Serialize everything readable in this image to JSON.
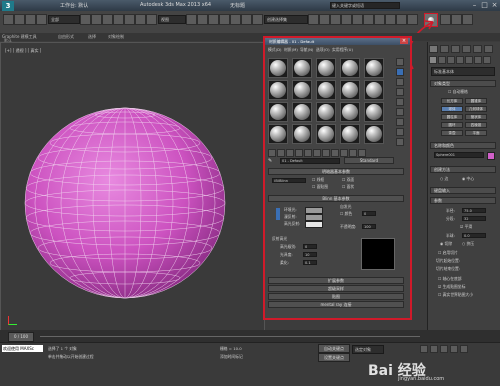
{
  "titlebar": {
    "app_title": "Autodesk 3ds Max 2013 x64",
    "workspace_label": "工作台: 默认",
    "search_placeholder": "键入关键字或短语",
    "untitled": "无标题"
  },
  "toolbar": {
    "filter_dropdown": "全部",
    "view_dropdown": "视图",
    "selection_set": "创建选择集"
  },
  "ribbon": {
    "tabs": [
      "Graphite 建模工具",
      "自由形式",
      "选择",
      "对象绘制"
    ],
    "sub_label": "默认"
  },
  "viewport": {
    "label": "[+] [ 透视 ] [ 真实 ]"
  },
  "material_editor": {
    "title": "材质编辑器 - 01 - Default",
    "menus": [
      "模式(D)",
      "材质(M)",
      "导航(N)",
      "选项(O)",
      "实用程序(U)"
    ],
    "material_name": "01 - Default",
    "material_type": "Standard",
    "shader_rollout": "明暗器基本参数",
    "shader_type": "(B)Blinn",
    "shader_checks": [
      "线框",
      "双面",
      "面贴图",
      "面状"
    ],
    "blinn_rollout": "Blinn 基本参数",
    "ambient_label": "环境光:",
    "diffuse_label": "漫反射:",
    "specular_label": "高光反射:",
    "self_illum_label": "自发光",
    "color_label": "颜色",
    "self_illum_value": "0",
    "opacity_label": "不透明度:",
    "opacity_value": "100",
    "highlight_label": "反射高光",
    "spec_level_label": "高光级别:",
    "spec_level_value": "0",
    "glossiness_label": "光泽度:",
    "glossiness_value": "10",
    "soften_label": "柔化:",
    "soften_value": "0.1",
    "rollouts": [
      "扩展参数",
      "超级采样",
      "贴图",
      "mental ray 连接"
    ]
  },
  "command_panel": {
    "dropdown": "标准基本体",
    "section_object_type": "对象类型",
    "autogrid": "自动栅格",
    "objects": [
      "长方体",
      "圆锥体",
      "球体",
      "几何球体",
      "圆柱体",
      "管状体",
      "圆环",
      "四棱锥",
      "茶壶",
      "平面"
    ],
    "section_name_color": "名称和颜色",
    "object_name": "Sphere001",
    "section_creation": "创建方法",
    "creation_options": [
      "边",
      "中心"
    ],
    "section_keyboard": "键盘输入",
    "section_params": "参数",
    "radius_label": "半径:",
    "radius_value": "75.0",
    "segments_label": "分段:",
    "segments_value": "32",
    "smooth_label": "平滑",
    "hemisphere_label": "半球:",
    "hemisphere_value": "0.0",
    "chop_label": "切除",
    "squash_label": "挤压",
    "slice_on_label": "启用切片",
    "slice_from_label": "切片起始位置:",
    "slice_to_label": "切片结束位置:",
    "pivot_label": "轴心在底部",
    "mapping_label": "生成贴图坐标",
    "realworld_label": "真实世界贴图大小"
  },
  "timeline": {
    "frame_display": "0 / 100"
  },
  "statusbar": {
    "selected": "选择了 1 个 对象",
    "prompt": "单击并拖动以开始创建过程",
    "welcome": "欢迎使用 MAXSc",
    "grid_label": "栅格 = 10.0",
    "add_time_tag": "添加时间标记",
    "auto_key": "自动关键点",
    "set_key": "设置关键点",
    "selected_object": "选定对象"
  },
  "watermark": {
    "text": "Bai 经验",
    "url": "jingyan.baidu.com"
  },
  "colors": {
    "sphere": "#d060c8",
    "highlight_red": "#d01a2a",
    "object_color": "#d060c8"
  }
}
